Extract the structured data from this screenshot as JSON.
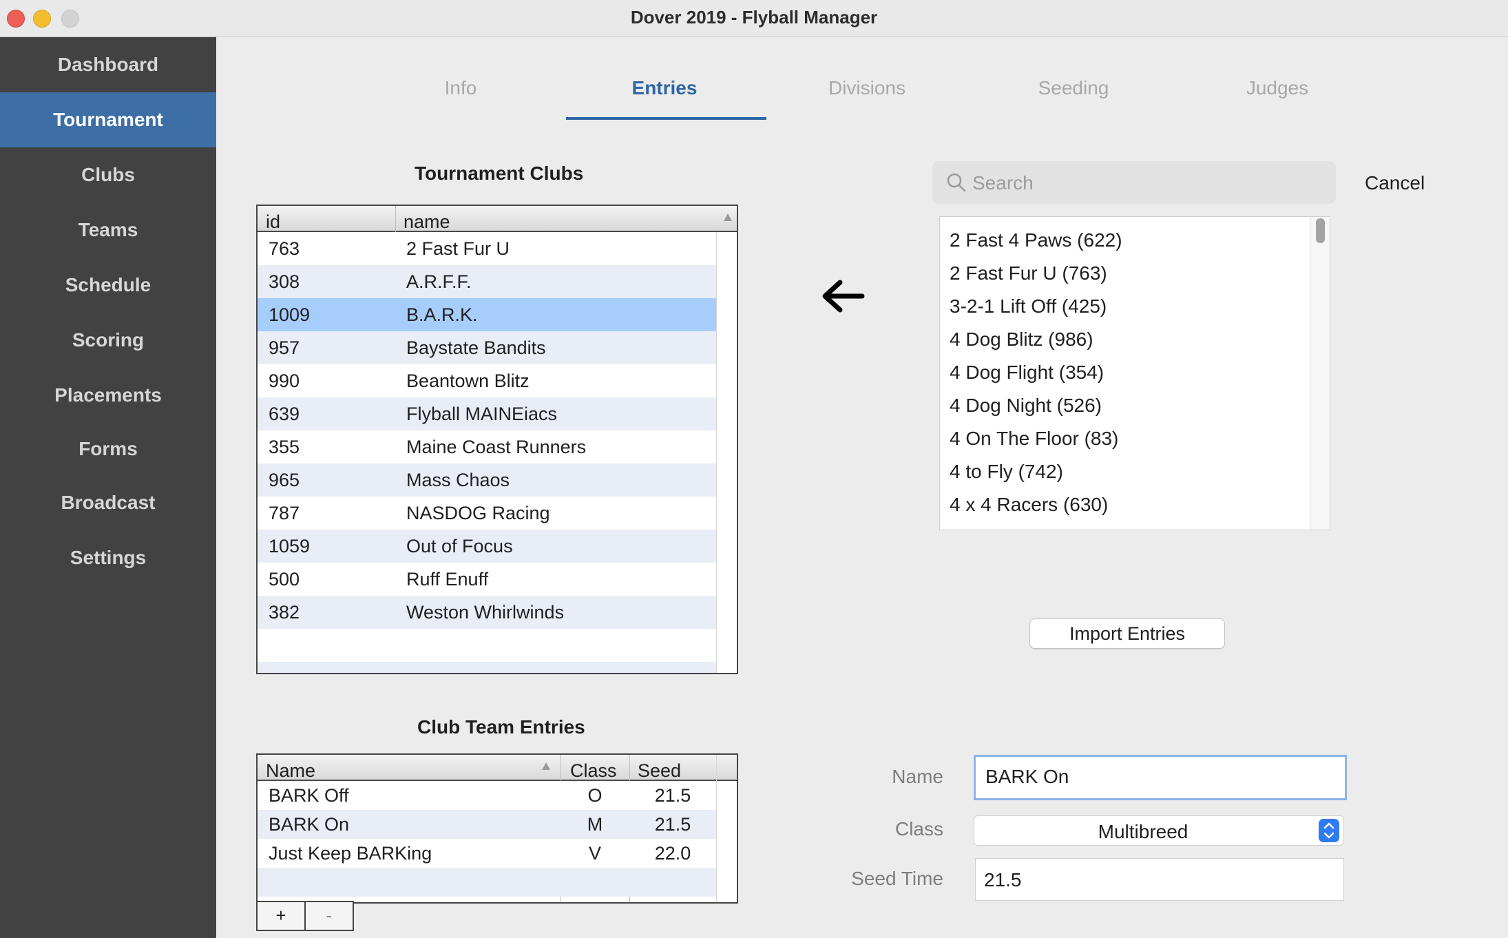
{
  "window": {
    "title": "Dover 2019 - Flyball Manager"
  },
  "sidebar": {
    "items": [
      "Dashboard",
      "Tournament",
      "Clubs",
      "Teams",
      "Schedule",
      "Scoring",
      "Placements",
      "Forms",
      "Broadcast",
      "Settings"
    ],
    "active": "Tournament"
  },
  "tabs": [
    "Info",
    "Entries",
    "Divisions",
    "Seeding",
    "Judges"
  ],
  "active_tab": "Entries",
  "tournament_clubs": {
    "title": "Tournament Clubs",
    "columns": [
      "id",
      "name"
    ],
    "rows": [
      [
        "763",
        "2 Fast Fur U"
      ],
      [
        "308",
        "A.R.F.F."
      ],
      [
        "1009",
        "B.A.R.K."
      ],
      [
        "957",
        "Baystate Bandits"
      ],
      [
        "990",
        "Beantown Blitz"
      ],
      [
        "639",
        "Flyball MAINEiacs"
      ],
      [
        "355",
        "Maine Coast Runners"
      ],
      [
        "965",
        "Mass Chaos"
      ],
      [
        "787",
        "NASDOG Racing"
      ],
      [
        "1059",
        "Out of Focus"
      ],
      [
        "500",
        "Ruff Enuff"
      ],
      [
        "382",
        "Weston Whirlwinds"
      ]
    ],
    "selected_index": 2
  },
  "club_team_entries": {
    "title": "Club Team Entries",
    "columns": [
      "Name",
      "Class",
      "Seed"
    ],
    "rows": [
      [
        "BARK Off",
        "O",
        "21.5"
      ],
      [
        "BARK On",
        "M",
        "21.5"
      ],
      [
        "Just Keep BARKing",
        "V",
        "22.0"
      ]
    ],
    "add_label": "+",
    "remove_label": "-"
  },
  "search": {
    "placeholder": "Search",
    "cancel_label": "Cancel"
  },
  "available_clubs": [
    "2 Fast 4 Paws (622)",
    "2 Fast Fur U (763)",
    "3-2-1 Lift Off (425)",
    "4 Dog Blitz (986)",
    "4 Dog Flight (354)",
    "4 Dog Night (526)",
    "4 On The Floor (83)",
    "4 to Fly (742)",
    "4 x 4 Racers (630)"
  ],
  "import_button": "Import Entries",
  "arrow_icon": "arrow-left-icon",
  "form": {
    "name_label": "Name",
    "name_value": "BARK On",
    "class_label": "Class",
    "class_value": "Multibreed",
    "seed_label": "Seed Time",
    "seed_value": "21.5"
  },
  "colors": {
    "sidebar_bg": "#424242",
    "sidebar_active": "#3d6ea6",
    "accent": "#2f66a3",
    "row_alt": "#e8edf6",
    "row_selected": "#a6cdfb"
  }
}
